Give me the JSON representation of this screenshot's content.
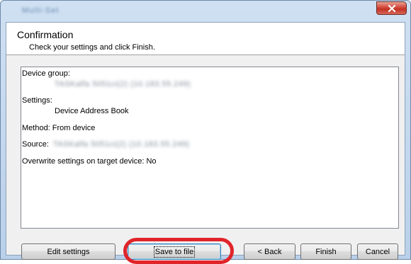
{
  "window": {
    "title": "Multi-Set",
    "close_symbol": "×"
  },
  "header": {
    "title": "Confirmation",
    "subtitle": "Check your settings and click Finish."
  },
  "summary": {
    "device_group_label": "Device group:",
    "device_group_value": "TASKalfa 5051ci(2) (10.183.55.249)",
    "settings_label": "Settings:",
    "settings_value": "Device Address Book",
    "method_line": "Method: From device",
    "source_label": "Source:",
    "source_value": "TASKalfa 5051ci(2) (10.183.55.249)",
    "overwrite_line": "Overwrite settings on target device: No"
  },
  "buttons": {
    "edit_settings": "Edit settings",
    "save_to_file": "Save to file",
    "back": "< Back",
    "finish": "Finish",
    "cancel": "Cancel"
  },
  "colors": {
    "highlight": "#e0242a",
    "close_button": "#c23323"
  }
}
